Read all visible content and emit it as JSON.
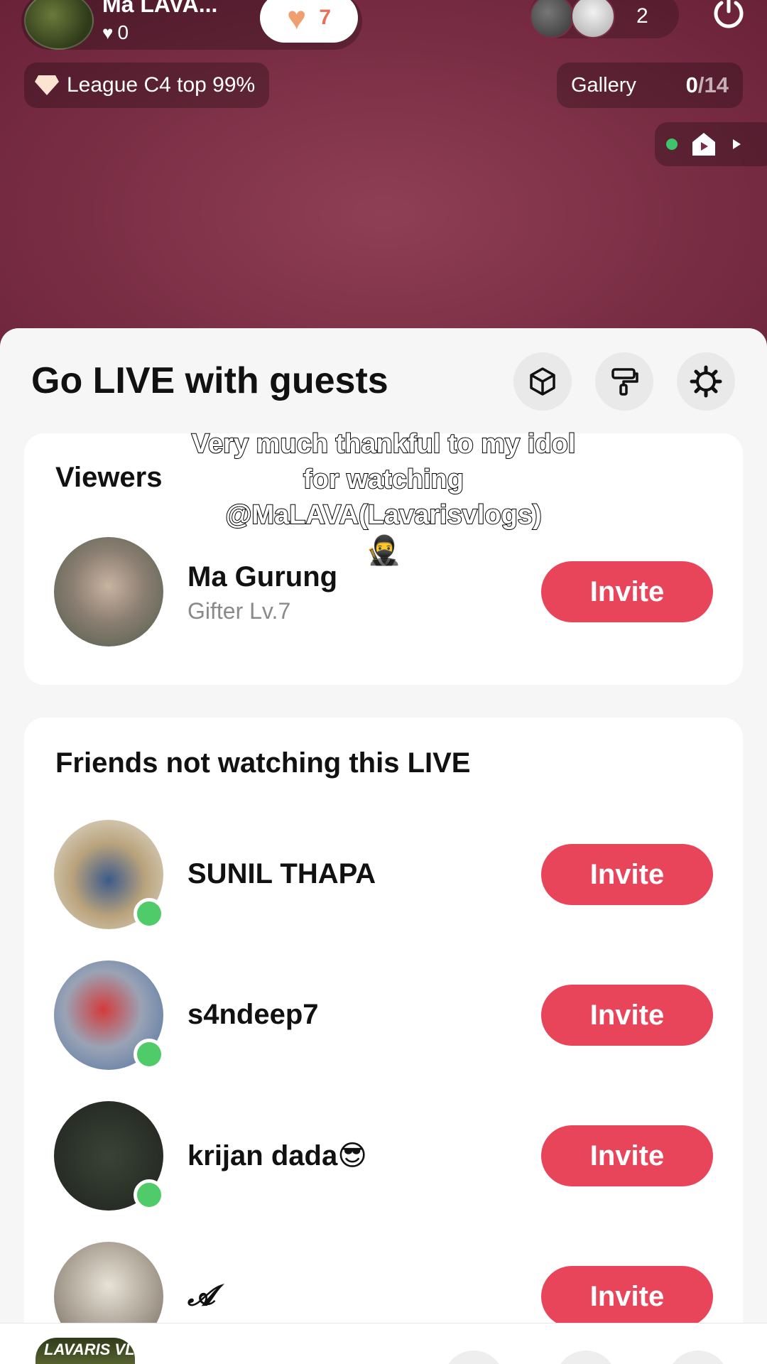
{
  "header": {
    "host_name": "Ma LAVA...",
    "host_likes": "0",
    "follow_count": "7",
    "viewer_count": "2",
    "league_text": "League C4 top 99%",
    "gallery_label": "Gallery",
    "gallery_count": "0",
    "gallery_total": "/14"
  },
  "sheet": {
    "title": "Go LIVE with guests",
    "viewers_title": "Viewers",
    "friends_title": "Friends not watching this LIVE",
    "invite_label": "Invite"
  },
  "viewers": [
    {
      "name": "Ma Gurung",
      "subtitle": "Gifter Lv.7"
    }
  ],
  "friends": [
    {
      "name": "SUNIL THAPA",
      "online": true
    },
    {
      "name": "s4ndeep7",
      "online": true
    },
    {
      "name": "krijan dada😎",
      "online": true
    },
    {
      "name": "𝓐",
      "online": false
    }
  ],
  "caption": {
    "text": "Very much thankful to my idol for watching @MaLAVA(Lavarisvlogs)",
    "emoji": "🥷"
  },
  "bottom": {
    "logo_text": "LAVARIS VLOG"
  },
  "colors": {
    "invite": "#e8445a",
    "online": "#4fcb6a",
    "live_bg": "#7a2e45"
  }
}
